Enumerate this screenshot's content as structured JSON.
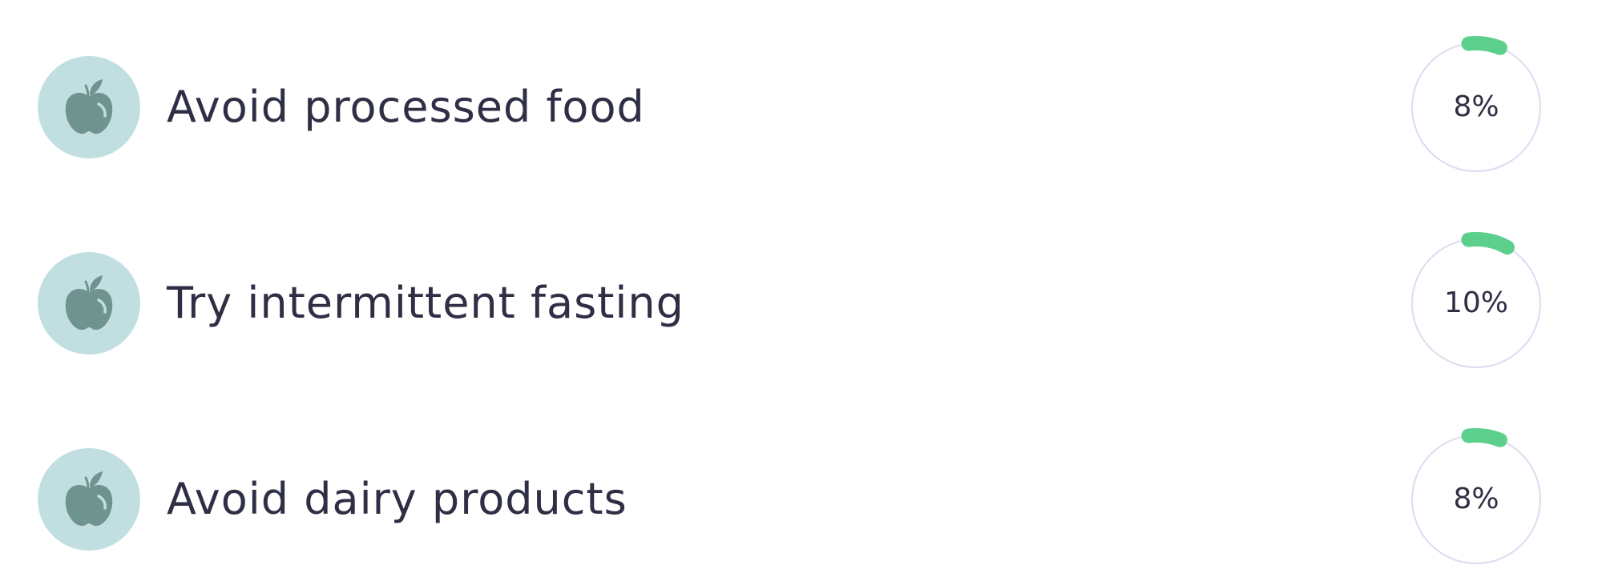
{
  "colors": {
    "avatar_bg": "#c1dfe1",
    "apple": "#6f938f",
    "apple_highlight": "#c1dfe1",
    "progress": "#5ccf8c",
    "track": "#dcdbf0",
    "text": "#2e2f45"
  },
  "items": [
    {
      "label": "Avoid processed food",
      "percent_text": "8%",
      "progress": 0.08,
      "icon": "apple-icon"
    },
    {
      "label": "Try intermittent fasting",
      "percent_text": "10%",
      "progress": 0.1,
      "icon": "apple-icon"
    },
    {
      "label": "Avoid dairy products",
      "percent_text": "8%",
      "progress": 0.08,
      "icon": "apple-icon"
    }
  ]
}
